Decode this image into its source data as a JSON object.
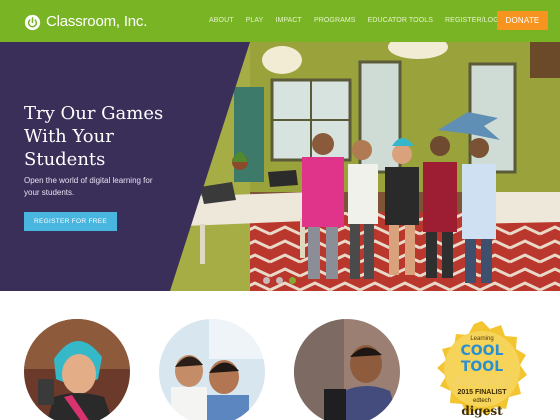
{
  "header": {
    "logo_text": "Classroom, Inc.",
    "nav": [
      "ABOUT",
      "PLAY",
      "IMPACT",
      "PROGRAMS",
      "EDUCATOR TOOLS",
      "REGISTER/LOGIN"
    ],
    "donate_label": "DONATE"
  },
  "hero": {
    "title_lines": [
      "Try Our Games",
      "With Your",
      "Students"
    ],
    "subtitle_lines": [
      "Open the world of digital learning for",
      "your students."
    ],
    "cta_label": "REGISTER FOR FREE",
    "carousel": {
      "slides": 3,
      "active_index": 2
    }
  },
  "award_badge": {
    "lines": [
      "Learning",
      "COOL",
      "TOOL",
      "AWARD",
      "2015 FINALIST",
      "edtech",
      "digest"
    ]
  },
  "colors": {
    "header_green": "#79b425",
    "donate_orange": "#f6941f",
    "hero_panel_purple": "#3a2f58",
    "cta_blue": "#49b6df",
    "dot_active": "#7db72f"
  },
  "icons": [
    "power-logo-icon"
  ]
}
